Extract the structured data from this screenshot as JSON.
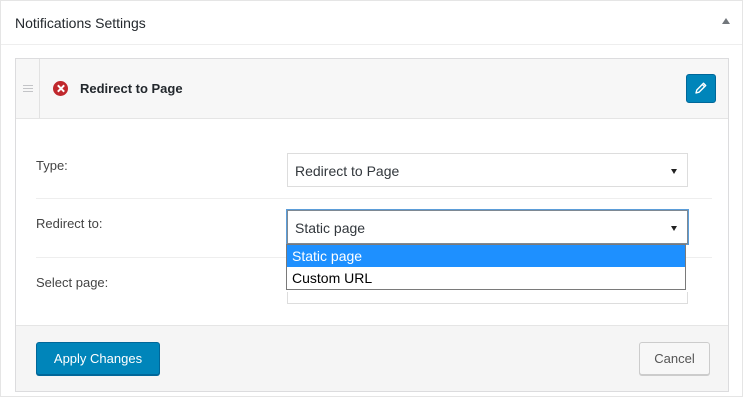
{
  "panel": {
    "title": "Notifications Settings",
    "collapse_icon": "triangle-up-icon"
  },
  "card": {
    "title": "Redirect to Page",
    "status_icon": "error-x-icon",
    "edit_icon": "pencil-icon"
  },
  "form": {
    "type": {
      "label": "Type:",
      "value": "Redirect to Page"
    },
    "redirect_to": {
      "label": "Redirect to:",
      "value": "Static page",
      "options": [
        "Static page",
        "Custom URL"
      ],
      "selected_index": 0
    },
    "select_page": {
      "label": "Select page:",
      "value": ""
    }
  },
  "footer": {
    "apply_label": "Apply Changes",
    "cancel_label": "Cancel"
  },
  "colors": {
    "primary": "#0085ba",
    "error": "#c0282d",
    "option_highlight": "#1e90ff"
  }
}
